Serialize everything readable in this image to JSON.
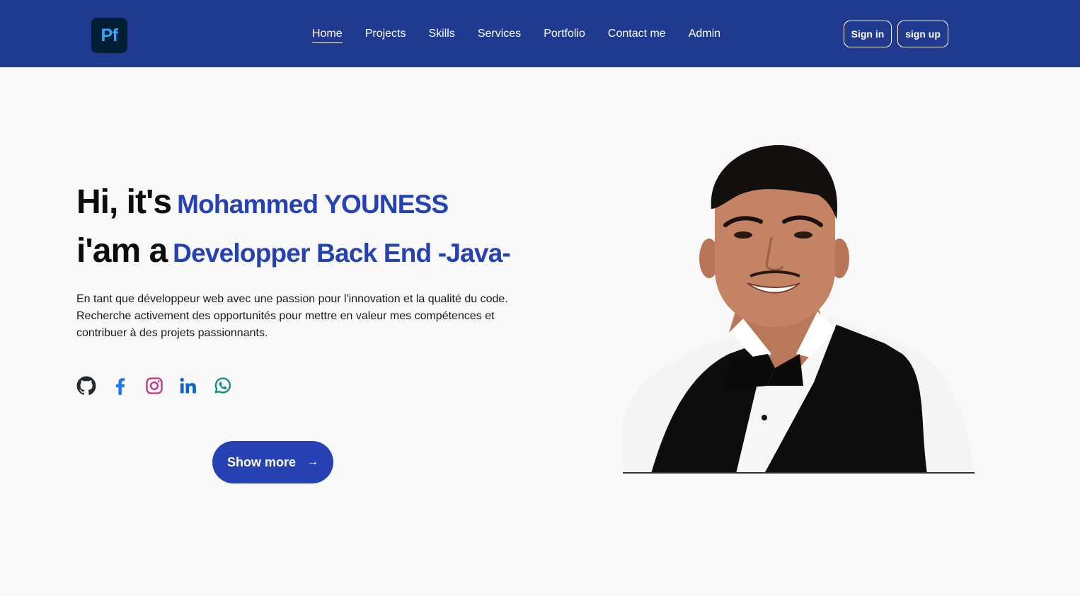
{
  "logo": {
    "text": "Pf"
  },
  "nav": {
    "items": [
      {
        "label": "Home",
        "active": true
      },
      {
        "label": "Projects"
      },
      {
        "label": "Skills"
      },
      {
        "label": "Services"
      },
      {
        "label": "Portfolio"
      },
      {
        "label": "Contact me"
      },
      {
        "label": "Admin"
      }
    ]
  },
  "auth": {
    "signin_label": "Sign in",
    "signup_label": "sign up"
  },
  "hero": {
    "greeting": "Hi, it's",
    "name": "Mohammed YOUNESS",
    "iam": "i'am a",
    "role": "Developper Back End -Java-",
    "description": "En tant que développeur web avec une passion pour l'innovation et la qualité du code. Recherche activement des opportunités pour mettre en valeur mes compétences et contribuer à des projets passionnants.",
    "button_label": "Show more"
  },
  "socials": [
    {
      "icon": "github-icon",
      "color": "#24292e"
    },
    {
      "icon": "facebook-icon",
      "color": "#1877f2"
    },
    {
      "icon": "instagram-icon",
      "color": "#c13584"
    },
    {
      "icon": "linkedin-icon",
      "color": "#0a66c2"
    },
    {
      "icon": "whatsapp-icon",
      "color": "#128c7e"
    }
  ],
  "colors": {
    "navbar": "#1f3a8f",
    "accent": "#2541b2",
    "background": "#f9f9f9"
  }
}
